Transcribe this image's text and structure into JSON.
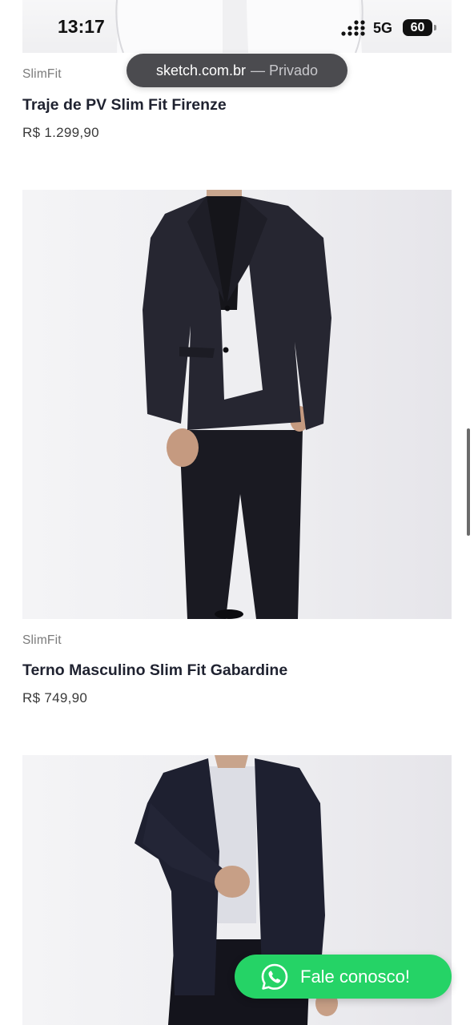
{
  "status_bar": {
    "time": "13:17",
    "network": "5G",
    "battery": "60"
  },
  "browser": {
    "domain": "sketch.com.br",
    "mode": "— Privado"
  },
  "products": [
    {
      "brand": "SlimFit",
      "title": "Traje de PV Slim Fit Firenze",
      "price": "R$ 1.299,90"
    },
    {
      "brand": "SlimFit",
      "title": "Terno Masculino Slim Fit Gabardine",
      "price": "R$ 749,90"
    }
  ],
  "whatsapp": {
    "label": "Fale conosco!",
    "icon": "whatsapp-icon",
    "color": "#25d366"
  }
}
